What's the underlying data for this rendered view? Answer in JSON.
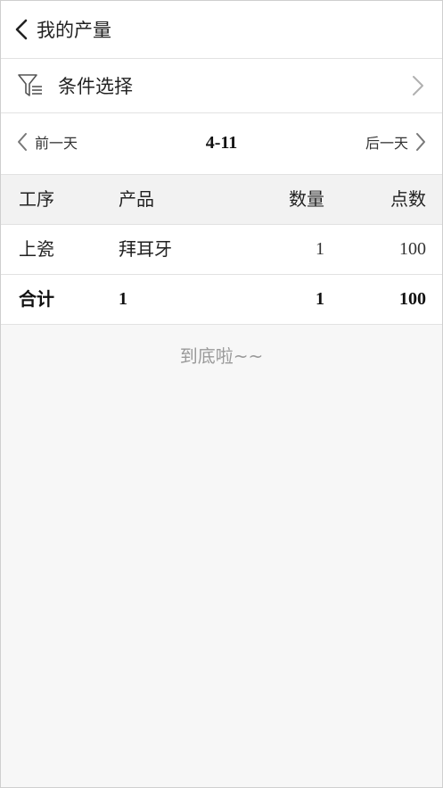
{
  "header": {
    "title": "我的产量"
  },
  "filter": {
    "label": "条件选择"
  },
  "date_nav": {
    "prev_label": "前一天",
    "date": "4-11",
    "next_label": "后一天"
  },
  "table": {
    "columns": [
      "工序",
      "产品",
      "数量",
      "点数"
    ],
    "rows": [
      {
        "process": "上瓷",
        "product": "拜耳牙",
        "quantity": "1",
        "points": "100"
      }
    ],
    "total": {
      "label": "合计",
      "product": "1",
      "quantity": "1",
      "points": "100"
    }
  },
  "footer": {
    "end_text": "到底啦~~"
  },
  "icons": {
    "back": "chevron-left-icon",
    "filter": "filter-icon",
    "chevron_right": "chevron-right-icon"
  },
  "colors": {
    "background": "#f7f7f7",
    "surface": "#ffffff",
    "header_row": "#f2f2f2",
    "muted_text": "#9a9a9a"
  }
}
